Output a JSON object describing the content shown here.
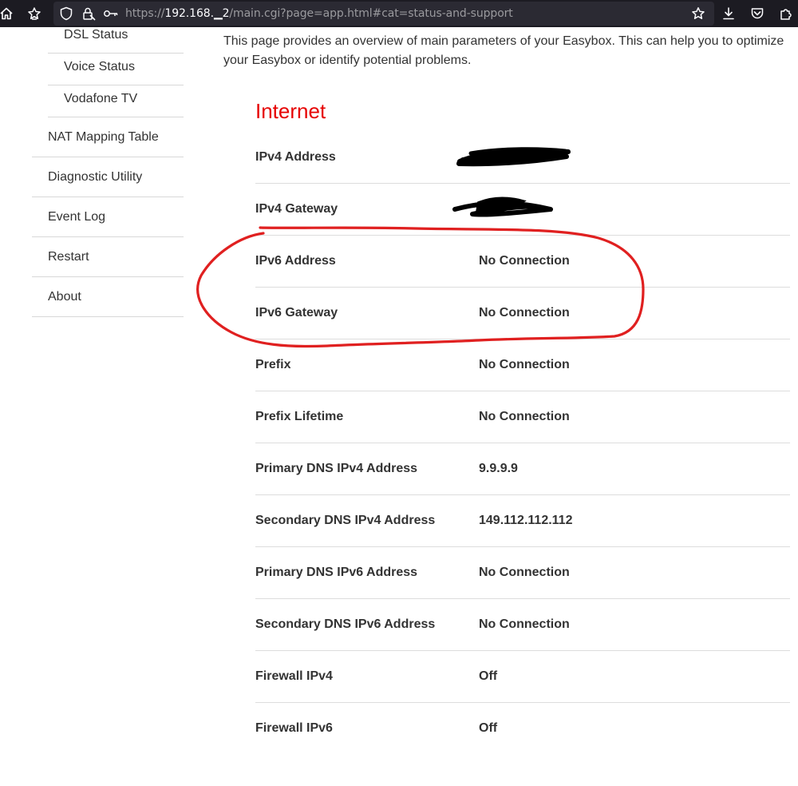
{
  "browser": {
    "url_scheme": "https://",
    "url_host": "192.168.",
    "url_host_rest": "2",
    "url_path": "/main.cgi?page=app.html#cat=status-and-support",
    "icons": [
      "home-icon",
      "extensions-puzzle-icon",
      "shield-icon",
      "lock-icon",
      "key-icon",
      "bookmark-star-icon",
      "download-icon",
      "pocket-icon",
      "extensions-icon"
    ]
  },
  "sidebar": {
    "sub_items": [
      {
        "label": "DSL Status"
      },
      {
        "label": "Voice Status"
      },
      {
        "label": "Vodafone TV"
      }
    ],
    "items": [
      {
        "label": "NAT Mapping Table"
      },
      {
        "label": "Diagnostic Utility"
      },
      {
        "label": "Event Log"
      },
      {
        "label": "Restart"
      },
      {
        "label": "About"
      }
    ]
  },
  "main": {
    "intro": "This page provides an overview of main parameters of your Easybox. This can help you to optimize your Easybox or identify potential problems.",
    "section_title": "Internet",
    "rows": [
      {
        "label": "IPv4 Address",
        "value": ""
      },
      {
        "label": "IPv4 Gateway",
        "value": ""
      },
      {
        "label": "IPv6 Address",
        "value": "No Connection"
      },
      {
        "label": "IPv6 Gateway",
        "value": "No Connection"
      },
      {
        "label": "Prefix",
        "value": "No Connection"
      },
      {
        "label": "Prefix Lifetime",
        "value": "No Connection"
      },
      {
        "label": "Primary DNS IPv4 Address",
        "value": "9.9.9.9"
      },
      {
        "label": "Secondary DNS IPv4 Address",
        "value": "149.112.112.112"
      },
      {
        "label": "Primary DNS IPv6 Address",
        "value": "No Connection"
      },
      {
        "label": "Secondary DNS IPv6 Address",
        "value": "No Connection"
      },
      {
        "label": "Firewall IPv4",
        "value": "Off"
      },
      {
        "label": "Firewall IPv6",
        "value": "Off"
      }
    ]
  },
  "annotation": {
    "color": "#e02020"
  },
  "colors": {
    "accent": "#e60000",
    "toolbar_bg": "#1c1b22",
    "urlbar_bg": "#2b2a33"
  }
}
